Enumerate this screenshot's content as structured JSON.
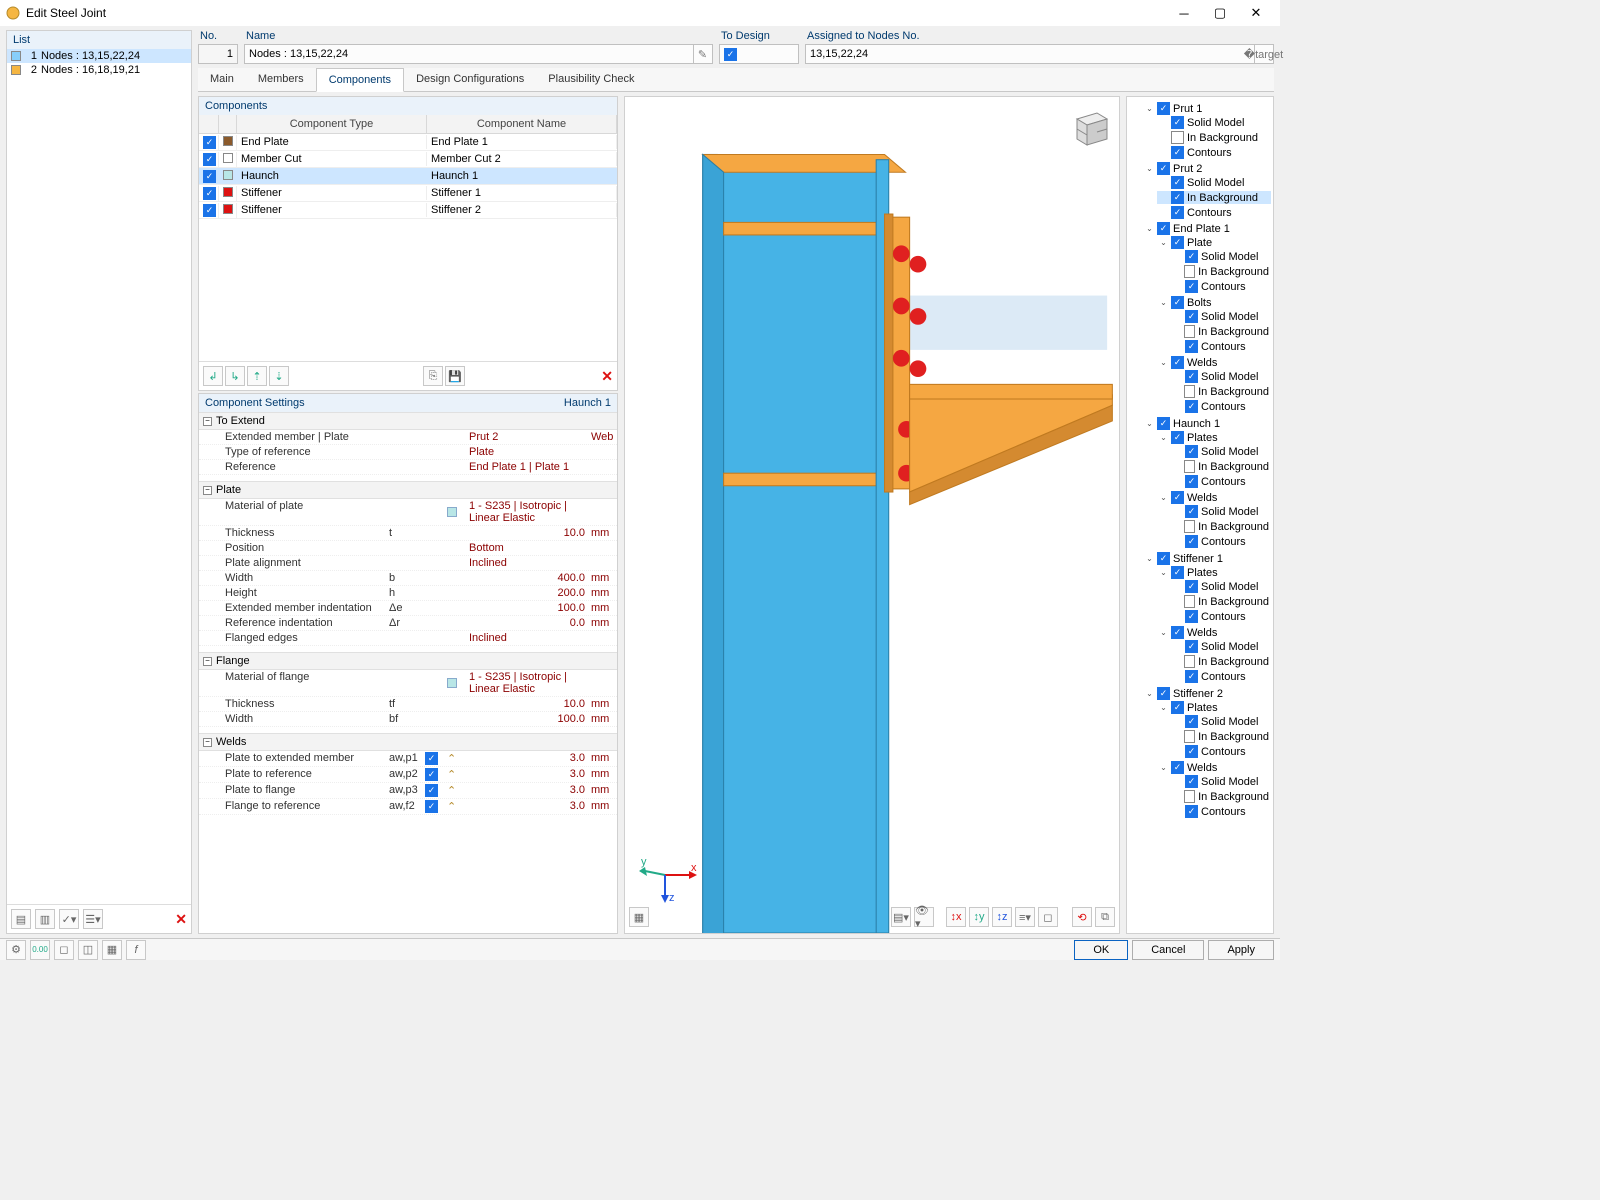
{
  "title": "Edit Steel Joint",
  "list": {
    "header": "List",
    "items": [
      {
        "num": "1",
        "label": "Nodes : 13,15,22,24",
        "color": "#87cefa",
        "selected": true
      },
      {
        "num": "2",
        "label": "Nodes : 16,18,19,21",
        "color": "#f5b642",
        "selected": false
      }
    ]
  },
  "fields": {
    "no_label": "No.",
    "no_value": "1",
    "name_label": "Name",
    "name_value": "Nodes : 13,15,22,24",
    "todesign_label": "To Design",
    "assigned_label": "Assigned to Nodes No.",
    "assigned_value": "13,15,22,24"
  },
  "tabs": [
    "Main",
    "Members",
    "Components",
    "Design Configurations",
    "Plausibility Check"
  ],
  "active_tab": 2,
  "components": {
    "header": "Components",
    "col1": "Component Type",
    "col2": "Component Name",
    "rows": [
      {
        "c": "#8b5a2b",
        "chk": true,
        "type": "End Plate",
        "name": "End Plate 1"
      },
      {
        "c": "#ffffff",
        "chk": true,
        "type": "Member Cut",
        "name": "Member Cut 2"
      },
      {
        "c": "#b8e6e6",
        "chk": true,
        "type": "Haunch",
        "name": "Haunch 1",
        "sel": true
      },
      {
        "c": "#d11",
        "chk": true,
        "type": "Stiffener",
        "name": "Stiffener 1"
      },
      {
        "c": "#d11",
        "chk": true,
        "type": "Stiffener",
        "name": "Stiffener 2"
      }
    ]
  },
  "settings": {
    "header": "Component Settings",
    "current": "Haunch 1",
    "groups": [
      {
        "name": "To Extend",
        "rows": [
          {
            "label": "Extended member | Plate",
            "val": "Prut 2",
            "extra": "Web"
          },
          {
            "label": "Type of reference",
            "val": "Plate"
          },
          {
            "label": "Reference",
            "val": "End Plate 1 | Plate 1"
          }
        ]
      },
      {
        "name": "Plate",
        "rows": [
          {
            "label": "Material of plate",
            "swatch": true,
            "val": "1 - S235 | Isotropic | Linear Elastic"
          },
          {
            "label": "Thickness",
            "sym": "t",
            "num": "10.0",
            "unit": "mm"
          },
          {
            "label": "Position",
            "val": "Bottom"
          },
          {
            "label": "Plate alignment",
            "val": "Inclined"
          },
          {
            "label": "Width",
            "sym": "b",
            "num": "400.0",
            "unit": "mm"
          },
          {
            "label": "Height",
            "sym": "h",
            "num": "200.0",
            "unit": "mm"
          },
          {
            "label": "Extended member indentation",
            "sym": "Δe",
            "num": "100.0",
            "unit": "mm"
          },
          {
            "label": "Reference indentation",
            "sym": "Δr",
            "num": "0.0",
            "unit": "mm"
          },
          {
            "label": "Flanged edges",
            "val": "Inclined"
          }
        ]
      },
      {
        "name": "Flange",
        "rows": [
          {
            "label": "Material of flange",
            "swatch": true,
            "val": "1 - S235 | Isotropic | Linear Elastic"
          },
          {
            "label": "Thickness",
            "sym": "tf",
            "num": "10.0",
            "unit": "mm"
          },
          {
            "label": "Width",
            "sym": "bf",
            "num": "100.0",
            "unit": "mm"
          }
        ]
      },
      {
        "name": "Welds",
        "rows": [
          {
            "label": "Plate to extended member",
            "sym": "aw,p1",
            "chk": true,
            "ico": true,
            "num": "3.0",
            "unit": "mm"
          },
          {
            "label": "Plate to reference",
            "sym": "aw,p2",
            "chk": true,
            "ico": true,
            "num": "3.0",
            "unit": "mm"
          },
          {
            "label": "Plate to flange",
            "sym": "aw,p3",
            "chk": true,
            "ico": true,
            "num": "3.0",
            "unit": "mm"
          },
          {
            "label": "Flange to reference",
            "sym": "aw,f2",
            "chk": true,
            "ico": true,
            "num": "3.0",
            "unit": "mm"
          }
        ]
      }
    ]
  },
  "tree": [
    {
      "l": "Prut 1",
      "c": true,
      "k": [
        {
          "l": "Solid Model",
          "c": true
        },
        {
          "l": "In Background",
          "c": false
        },
        {
          "l": "Contours",
          "c": true
        }
      ]
    },
    {
      "l": "Prut 2",
      "c": true,
      "k": [
        {
          "l": "Solid Model",
          "c": true
        },
        {
          "l": "In Background",
          "c": true,
          "sel": true
        },
        {
          "l": "Contours",
          "c": true
        }
      ]
    },
    {
      "l": "End Plate 1",
      "c": true,
      "k": [
        {
          "l": "Plate",
          "c": true,
          "k": [
            {
              "l": "Solid Model",
              "c": true
            },
            {
              "l": "In Background",
              "c": false
            },
            {
              "l": "Contours",
              "c": true
            }
          ]
        },
        {
          "l": "Bolts",
          "c": true,
          "k": [
            {
              "l": "Solid Model",
              "c": true
            },
            {
              "l": "In Background",
              "c": false
            },
            {
              "l": "Contours",
              "c": true
            }
          ]
        },
        {
          "l": "Welds",
          "c": true,
          "k": [
            {
              "l": "Solid Model",
              "c": true
            },
            {
              "l": "In Background",
              "c": false
            },
            {
              "l": "Contours",
              "c": true
            }
          ]
        }
      ]
    },
    {
      "l": "Haunch 1",
      "c": true,
      "k": [
        {
          "l": "Plates",
          "c": true,
          "k": [
            {
              "l": "Solid Model",
              "c": true
            },
            {
              "l": "In Background",
              "c": false
            },
            {
              "l": "Contours",
              "c": true
            }
          ]
        },
        {
          "l": "Welds",
          "c": true,
          "k": [
            {
              "l": "Solid Model",
              "c": true
            },
            {
              "l": "In Background",
              "c": false
            },
            {
              "l": "Contours",
              "c": true
            }
          ]
        }
      ]
    },
    {
      "l": "Stiffener 1",
      "c": true,
      "k": [
        {
          "l": "Plates",
          "c": true,
          "k": [
            {
              "l": "Solid Model",
              "c": true
            },
            {
              "l": "In Background",
              "c": false
            },
            {
              "l": "Contours",
              "c": true
            }
          ]
        },
        {
          "l": "Welds",
          "c": true,
          "k": [
            {
              "l": "Solid Model",
              "c": true
            },
            {
              "l": "In Background",
              "c": false
            },
            {
              "l": "Contours",
              "c": true
            }
          ]
        }
      ]
    },
    {
      "l": "Stiffener 2",
      "c": true,
      "k": [
        {
          "l": "Plates",
          "c": true,
          "k": [
            {
              "l": "Solid Model",
              "c": true
            },
            {
              "l": "In Background",
              "c": false
            },
            {
              "l": "Contours",
              "c": true
            }
          ]
        },
        {
          "l": "Welds",
          "c": true,
          "k": [
            {
              "l": "Solid Model",
              "c": true
            },
            {
              "l": "In Background",
              "c": false
            },
            {
              "l": "Contours",
              "c": true
            }
          ]
        }
      ]
    }
  ],
  "buttons": {
    "ok": "OK",
    "cancel": "Cancel",
    "apply": "Apply"
  },
  "axes": {
    "x": "x",
    "y": "y",
    "z": "z"
  }
}
